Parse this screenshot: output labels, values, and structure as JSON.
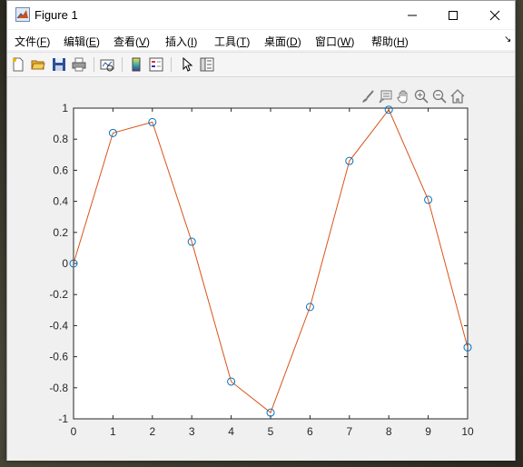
{
  "window": {
    "title": "Figure 1",
    "minimize_glyph": "—",
    "maximize_glyph": "☐",
    "close_glyph": "✕"
  },
  "menu": {
    "items": [
      {
        "label": "文件",
        "key": "F"
      },
      {
        "label": "编辑",
        "key": "E"
      },
      {
        "label": "查看",
        "key": "V"
      },
      {
        "label": "插入",
        "key": "I"
      },
      {
        "label": "工具",
        "key": "T"
      },
      {
        "label": "桌面",
        "key": "D"
      },
      {
        "label": "窗口",
        "key": "W"
      },
      {
        "label": "帮助",
        "key": "H"
      }
    ],
    "overflow_glyph": "↘"
  },
  "toolbar": {
    "icons": [
      "new-figure-icon",
      "open-icon",
      "save-icon",
      "print-icon",
      "link-plot-icon",
      "colorbar-icon",
      "legend-icon",
      "edit-plot-icon",
      "property-inspector-icon"
    ]
  },
  "axes_toolbar": {
    "icons": [
      "brush-icon",
      "data-tips-icon",
      "pan-icon",
      "zoom-in-icon",
      "zoom-out-icon",
      "home-icon"
    ]
  },
  "colors": {
    "line": "#d95319",
    "marker": "#0072bd",
    "axes_bg": "#ffffff",
    "figure_bg": "#f0f0f0"
  },
  "chart_data": {
    "type": "line",
    "x": [
      0,
      1,
      2,
      3,
      4,
      5,
      6,
      7,
      8,
      9,
      10
    ],
    "series": [
      {
        "name": "",
        "values": [
          0.0,
          0.84,
          0.91,
          0.14,
          -0.76,
          -0.96,
          -0.28,
          0.66,
          0.99,
          0.41,
          -0.54
        ],
        "style": "line",
        "color": "#d95319"
      },
      {
        "name": "",
        "values": [
          0.0,
          0.84,
          0.91,
          0.14,
          -0.76,
          -0.96,
          -0.28,
          0.66,
          0.99,
          0.41,
          -0.54
        ],
        "style": "marker-circle",
        "color": "#0072bd"
      }
    ],
    "xlim": [
      0,
      10
    ],
    "ylim": [
      -1,
      1
    ],
    "xticks": [
      "0",
      "1",
      "2",
      "3",
      "4",
      "5",
      "6",
      "7",
      "8",
      "9",
      "10"
    ],
    "yticks": [
      "1",
      "0.8",
      "0.6",
      "0.4",
      "0.2",
      "0",
      "-0.2",
      "-0.4",
      "-0.6",
      "-0.8",
      "-1"
    ],
    "title": "",
    "xlabel": "",
    "ylabel": "",
    "grid": false
  }
}
